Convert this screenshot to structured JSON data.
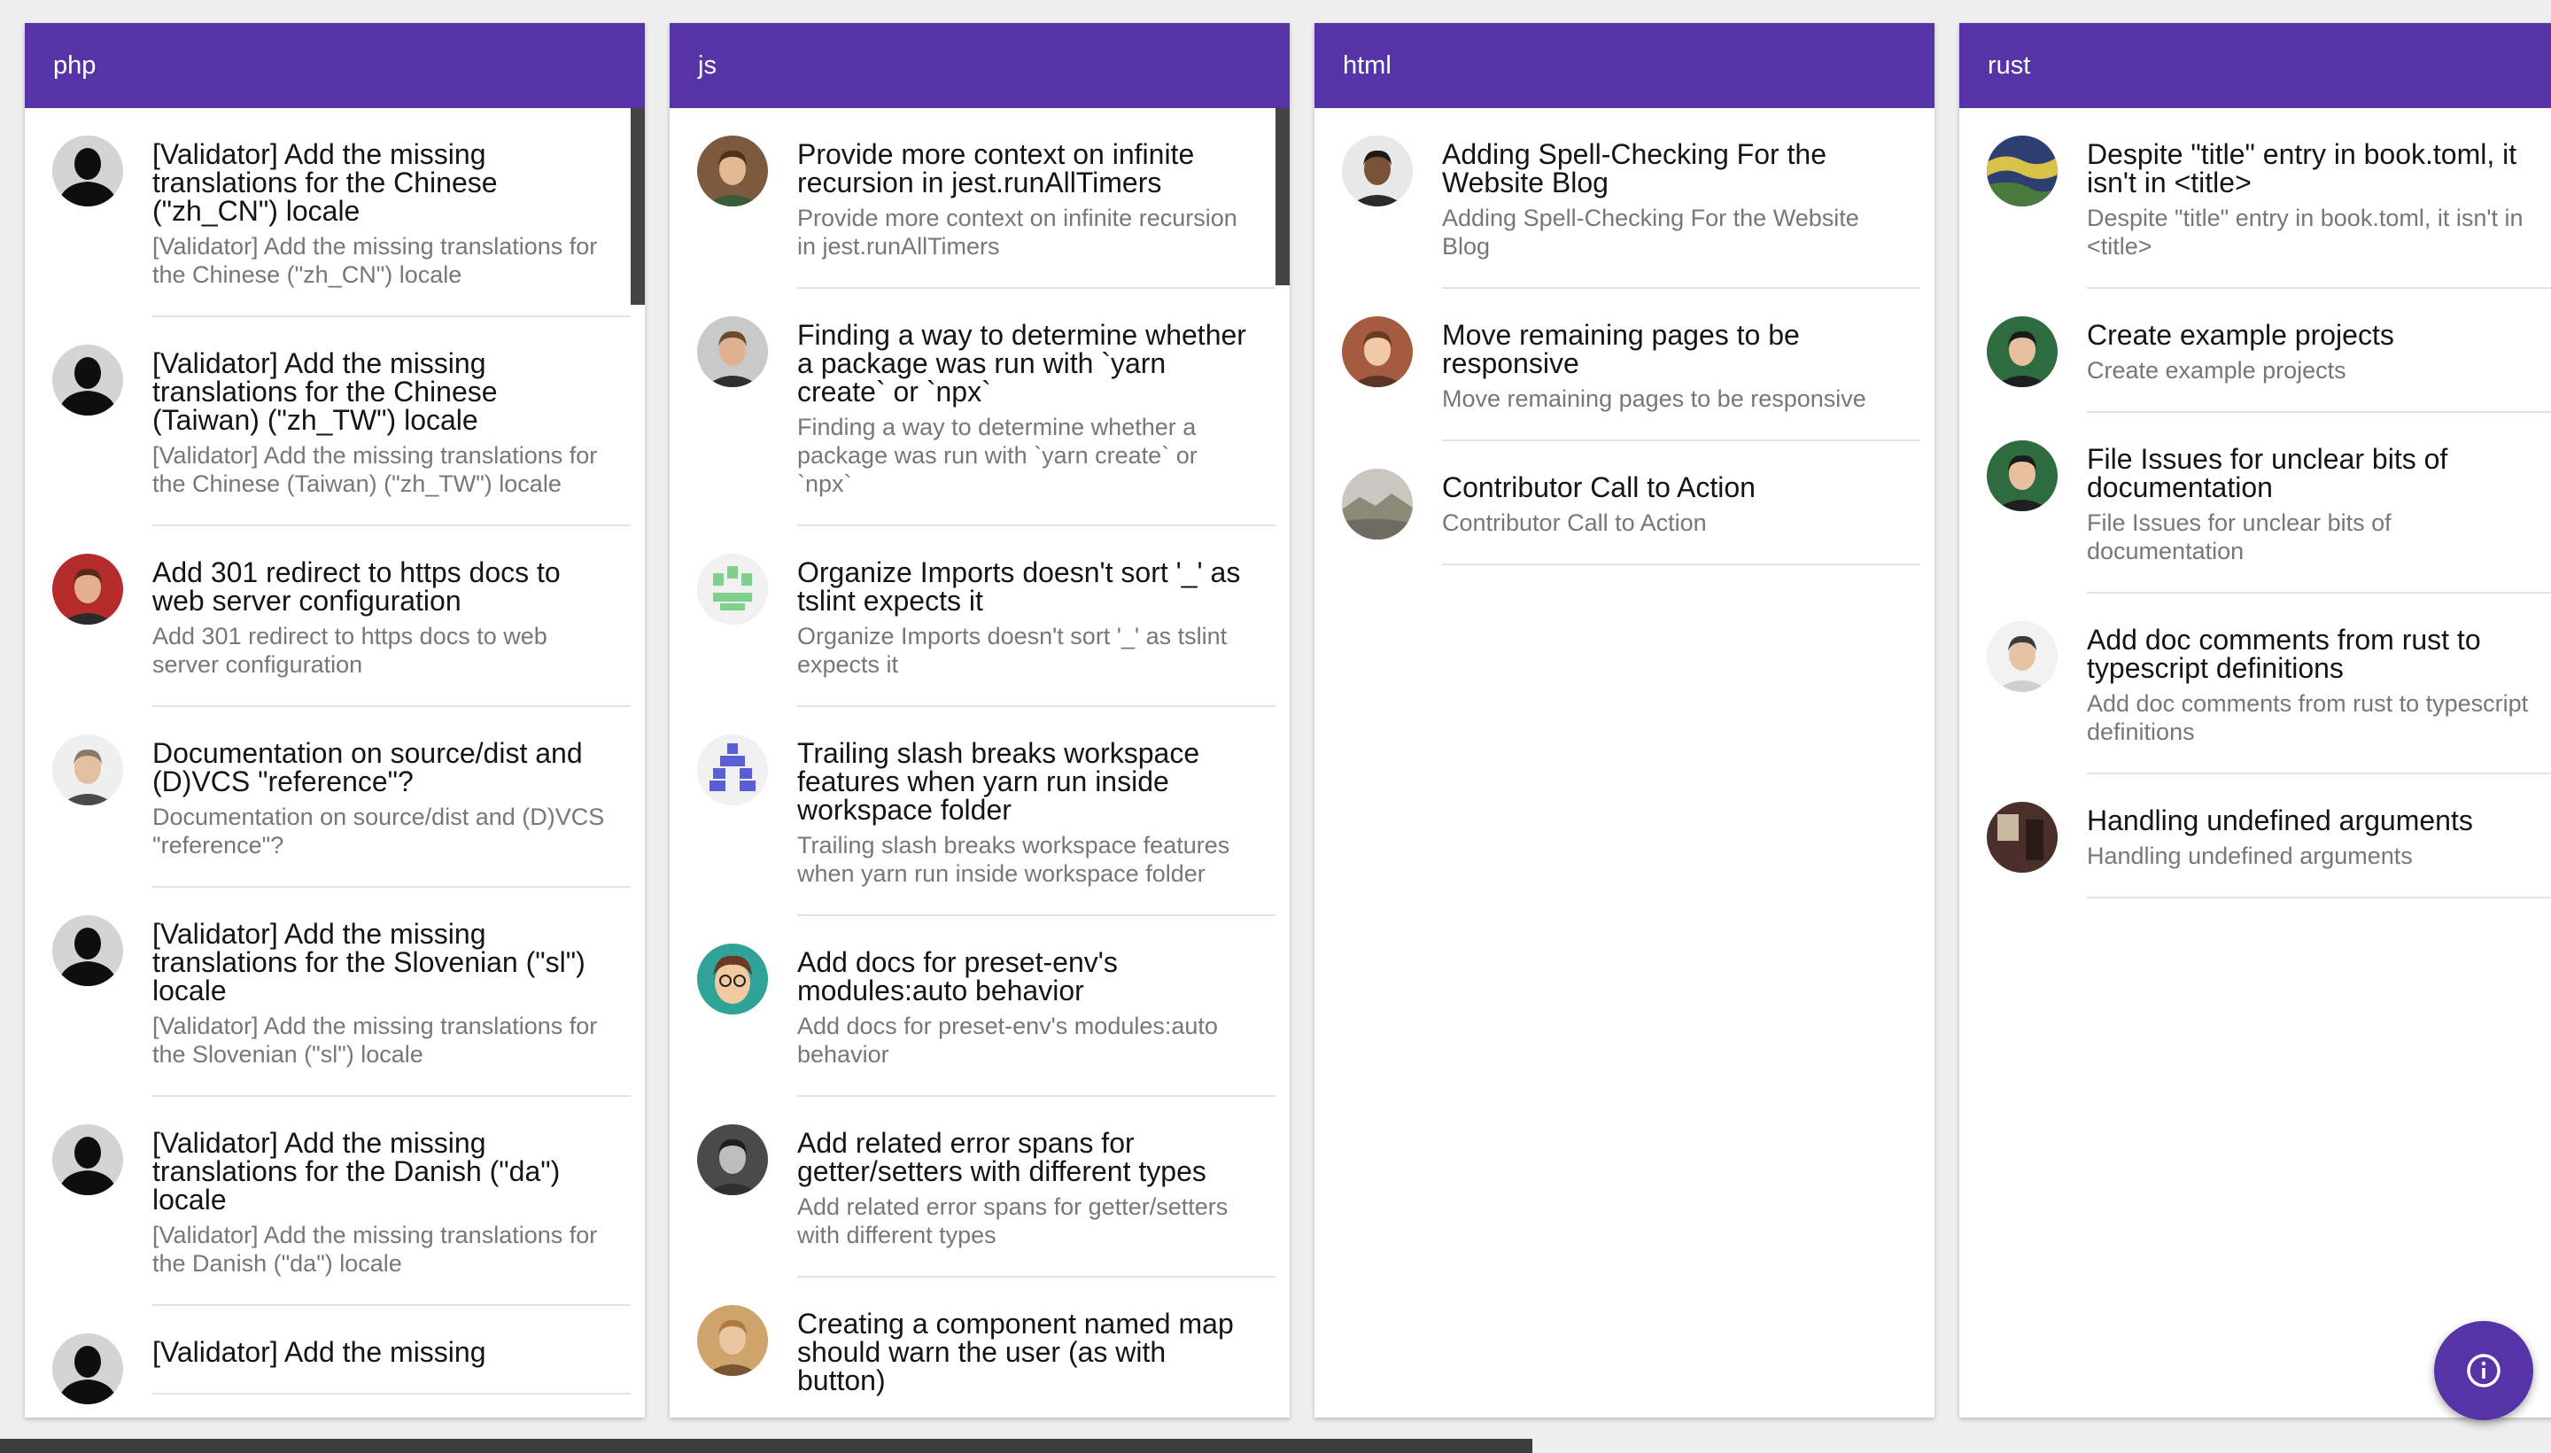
{
  "theme": {
    "header_color": "#5634a8",
    "fab_color": "#5634a8"
  },
  "fab": {
    "icon": "info-icon"
  },
  "columns": [
    {
      "name": "php",
      "items": [
        {
          "title": "[Validator] Add the missing translations for the Chinese (\"zh_CN\") locale",
          "subtitle": "[Validator] Add the missing translations for the Chinese (\"zh_CN\") locale",
          "avatar": "silhouette"
        },
        {
          "title": "[Validator] Add the missing translations for the Chinese (Taiwan) (\"zh_TW\") locale",
          "subtitle": "[Validator] Add the missing translations for the Chinese (Taiwan) (\"zh_TW\") locale",
          "avatar": "silhouette"
        },
        {
          "title": "Add 301 redirect to https docs to web server configuration",
          "subtitle": "Add 301 redirect to https docs to web server configuration",
          "avatar": "photo-red"
        },
        {
          "title": "Documentation on source/dist and (D)VCS \"reference\"?",
          "subtitle": "Documentation on source/dist and (D)VCS \"reference\"?",
          "avatar": "photo-glasses"
        },
        {
          "title": "[Validator] Add the missing translations for the Slovenian (\"sl\") locale",
          "subtitle": "[Validator] Add the missing translations for the Slovenian (\"sl\") locale",
          "avatar": "silhouette"
        },
        {
          "title": "[Validator] Add the missing translations for the Danish (\"da\") locale",
          "subtitle": "[Validator] Add the missing translations for the Danish (\"da\") locale",
          "avatar": "silhouette"
        },
        {
          "title": "[Validator] Add the missing",
          "subtitle": "",
          "avatar": "silhouette"
        }
      ]
    },
    {
      "name": "js",
      "items": [
        {
          "title": "Provide more context on infinite recursion in jest.runAllTimers",
          "subtitle": "Provide more context on infinite recursion in jest.runAllTimers",
          "avatar": "photo-brown"
        },
        {
          "title": "Finding a way to determine whether a package was run with `yarn create` or `npx`",
          "subtitle": "Finding a way to determine whether a package was run with `yarn create` or `npx`",
          "avatar": "photo-beard"
        },
        {
          "title": "Organize Imports doesn't sort '_' as tslint expects it",
          "subtitle": "Organize Imports doesn't sort '_' as tslint expects it",
          "avatar": "identicon-green"
        },
        {
          "title": "Trailing slash breaks workspace features when yarn run inside workspace folder",
          "subtitle": "Trailing slash breaks workspace features when yarn run inside workspace folder",
          "avatar": "identicon-blue"
        },
        {
          "title": "Add docs for preset-env's modules:auto behavior",
          "subtitle": "Add docs for preset-env's modules:auto behavior",
          "avatar": "cartoon-teal"
        },
        {
          "title": "Add related error spans for getter/setters with different types",
          "subtitle": "Add related error spans for getter/setters with different types",
          "avatar": "photo-bw"
        },
        {
          "title": "Creating a component named map should warn the user (as with button)",
          "subtitle": "",
          "avatar": "photo-tan"
        }
      ]
    },
    {
      "name": "html",
      "items": [
        {
          "title": "Adding Spell-Checking For the Website Blog",
          "subtitle": "Adding Spell-Checking For the Website Blog",
          "avatar": "photo-dark"
        },
        {
          "title": "Move remaining pages to be responsive",
          "subtitle": "Move remaining pages to be responsive",
          "avatar": "photo-smile"
        },
        {
          "title": "Contributor Call to Action",
          "subtitle": "Contributor Call to Action",
          "avatar": "photo-landscape"
        }
      ]
    },
    {
      "name": "rust",
      "items": [
        {
          "title": "Despite \"title\" entry in book.toml, it isn't in <title>",
          "subtitle": "Despite \"title\" entry in book.toml, it isn't in <title>",
          "avatar": "photo-painting"
        },
        {
          "title": "Create example projects",
          "subtitle": "Create example projects",
          "avatar": "photo-green"
        },
        {
          "title": "File Issues for unclear bits of documentation",
          "subtitle": "File Issues for unclear bits of documentation",
          "avatar": "photo-green"
        },
        {
          "title": "Add doc comments from rust to typescript definitions",
          "subtitle": "Add doc comments from rust to typescript definitions",
          "avatar": "photo-light"
        },
        {
          "title": "Handling undefined arguments",
          "subtitle": "Handling undefined arguments",
          "avatar": "photo-room"
        }
      ]
    }
  ]
}
